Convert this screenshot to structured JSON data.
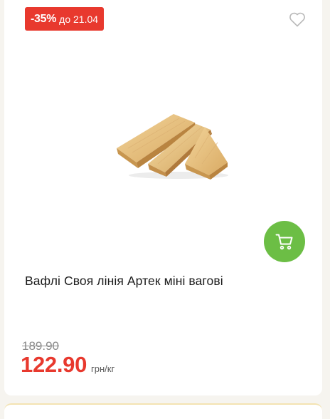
{
  "badge": {
    "discount": "-35%",
    "until": "до 21.04"
  },
  "product": {
    "title": "Вафлі Своя лінія Артек міні вагові",
    "old_price": "189.90",
    "price": "122.90",
    "unit": "грн/кг"
  },
  "icons": {
    "favorite": "heart-outline-icon",
    "cart": "shopping-cart-icon"
  },
  "colors": {
    "accent_red": "#e8392e",
    "cart_green": "#6cbe45",
    "background": "#f6f4ef"
  }
}
